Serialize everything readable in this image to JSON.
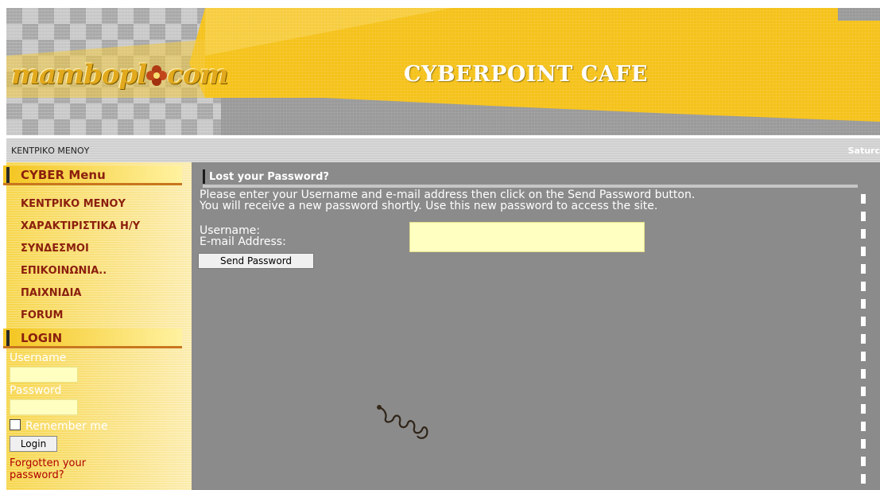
{
  "header": {
    "logo_text_left": "mambopl",
    "logo_text_right": "com",
    "site_title": "CYBERPOINT CAFE"
  },
  "topbar": {
    "path": "ΚΕΝΤΡΙΚΟ ΜΕΝΟΥ",
    "date": "Saturc"
  },
  "sidebar": {
    "menu_title": "CYBER Menu",
    "items": [
      {
        "label": "ΚΕΝΤΡΙΚΟ ΜΕΝΟΥ"
      },
      {
        "label": "ΧΑΡΑΚΤΙΡΙΣΤΙΚΑ Η/Υ"
      },
      {
        "label": "ΣΥΝΔΕΣΜΟΙ"
      },
      {
        "label": "ΕΠΙΚΟΙΝΩΝΙΑ.."
      },
      {
        "label": "ΠΑΙΧΝΙΔΙΑ"
      },
      {
        "label": "FORUM"
      }
    ],
    "login": {
      "title": "LOGIN",
      "username_label": "Username",
      "password_label": "Password",
      "remember_label": "Remember me",
      "login_button": "Login",
      "forgot_link": "Forgotten your password?"
    }
  },
  "main": {
    "heading": "Lost your Password?",
    "intro_line1": "Please enter your Username and e-mail address then click on the Send Password button.",
    "intro_line2": "You will receive a new password shortly. Use this new password to access the site.",
    "username_label": "Username:",
    "email_label": "E-mail Address:",
    "send_button": "Send Password"
  },
  "colors": {
    "banner_yellow": "#f5c21b",
    "sidebar_yellow": "#f7d64c",
    "menu_text": "#8b1f0e",
    "content_gray": "#8b8b8b",
    "input_yellow": "#ffffc2"
  }
}
